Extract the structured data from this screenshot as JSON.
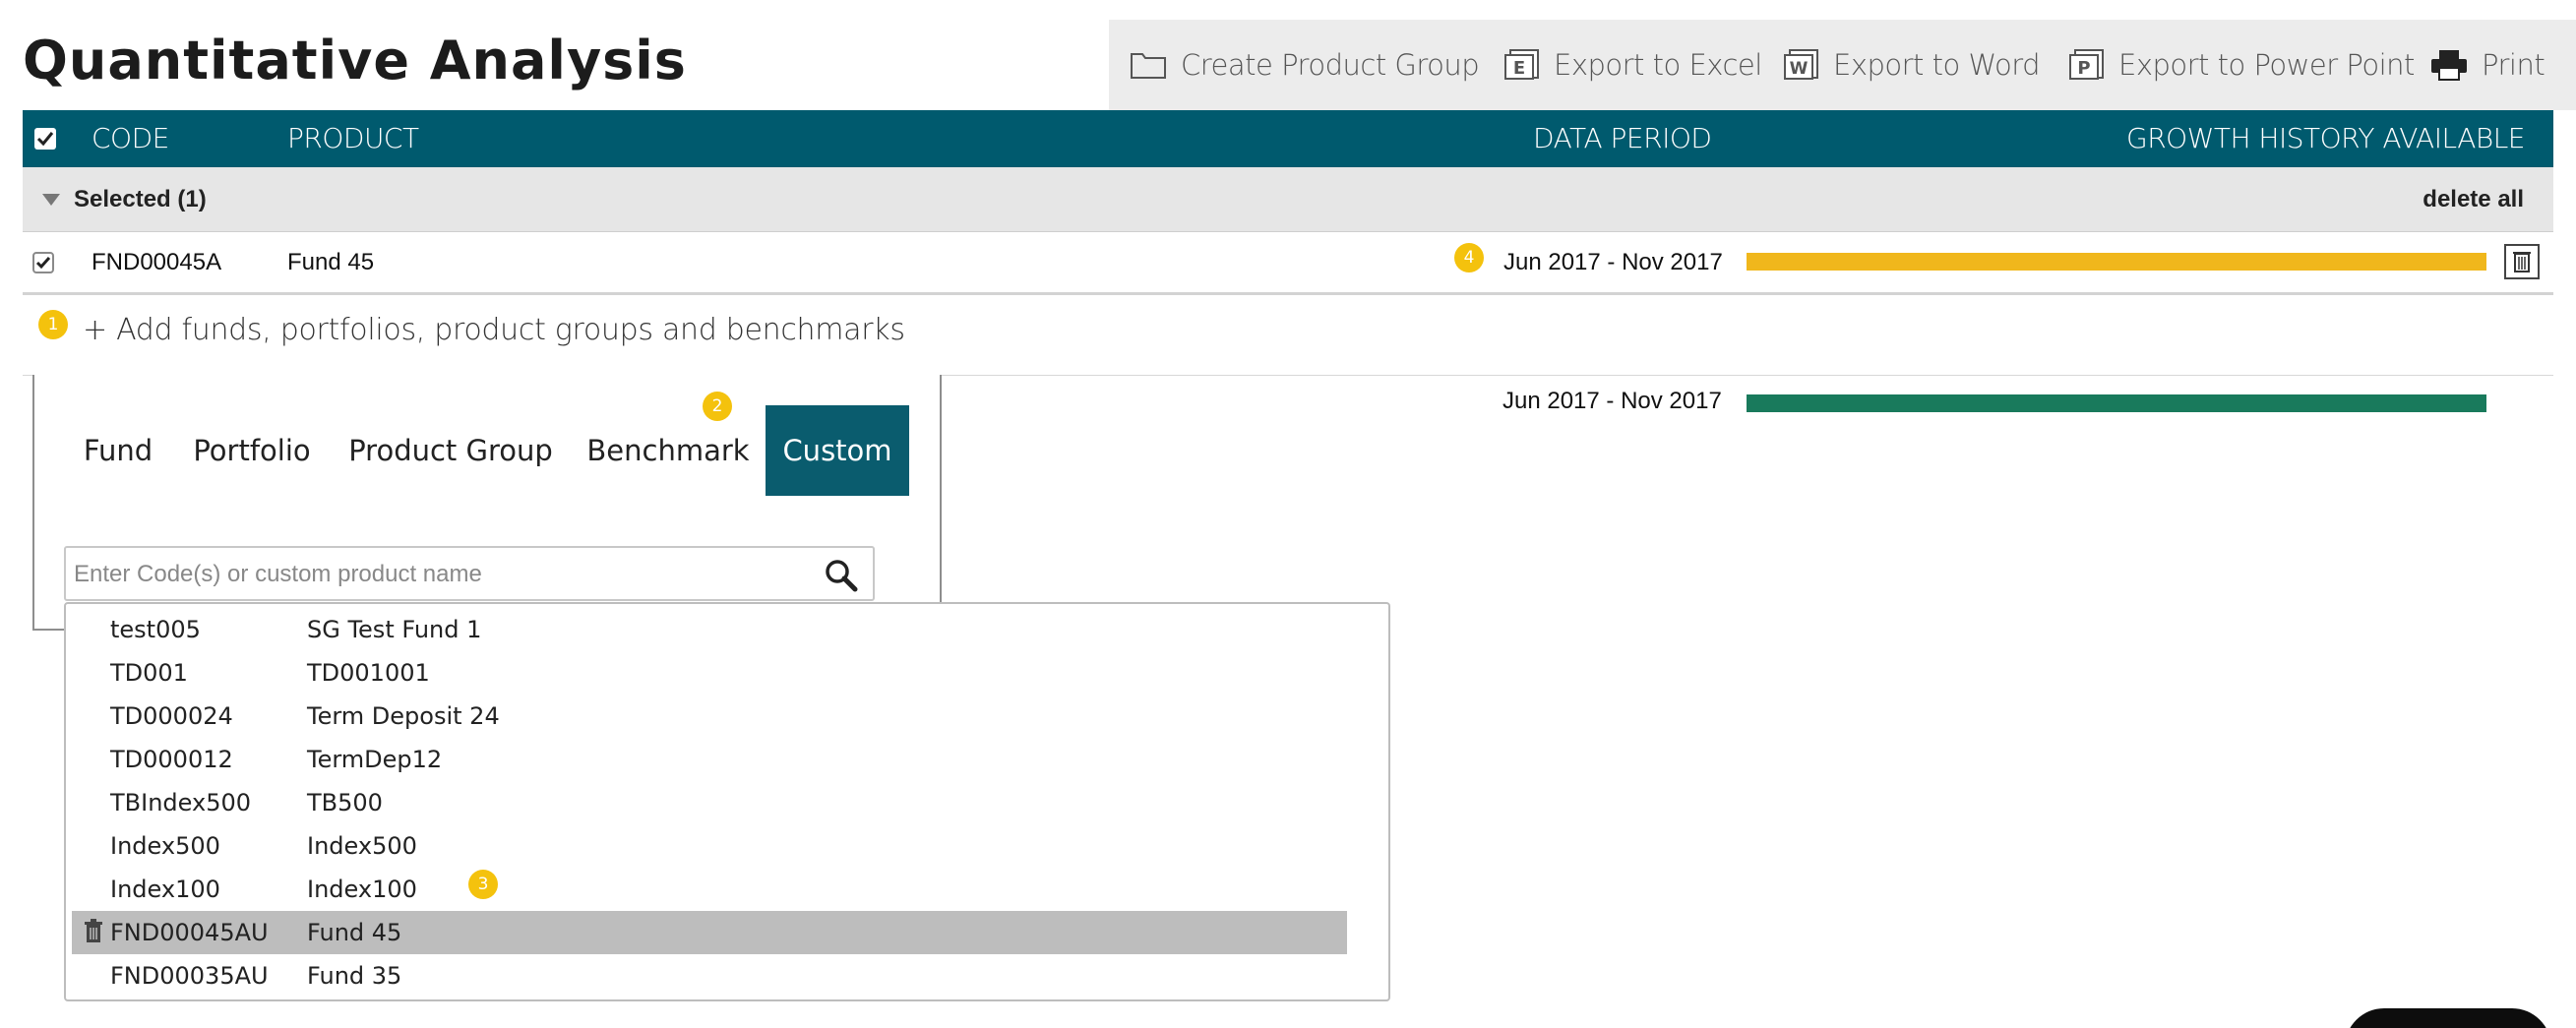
{
  "page": {
    "title": "Quantitative Analysis"
  },
  "toolbar": {
    "create_group": "Create Product Group",
    "export_excel": "Export to Excel",
    "export_word": "Export to Word",
    "export_ppt": "Export to Power Point",
    "print": "Print"
  },
  "table": {
    "columns": {
      "code": "CODE",
      "product": "PRODUCT",
      "data_period": "DATA PERIOD",
      "growth_history": "GROWTH HISTORY AVAILABLE"
    }
  },
  "group": {
    "label": "Selected (1)",
    "delete_all": "delete all"
  },
  "selected_row": {
    "code": "FND00045A",
    "product": "Fund 45",
    "period": "Jun 2017 - Nov 2017",
    "checked": true,
    "bar_color": "#f0b71c",
    "bar_fraction": 1.0
  },
  "badges": {
    "b1": "1",
    "b2": "2",
    "b3": "3",
    "b4": "4"
  },
  "add_link": "+ Add funds, portfolios, product groups and benchmarks",
  "benchmark_row": {
    "period": "Jun 2017 - Nov 2017",
    "bar_color": "#197a5c",
    "bar_fraction": 1.0
  },
  "tabs": [
    {
      "label": "Fund",
      "active": false
    },
    {
      "label": "Portfolio",
      "active": false
    },
    {
      "label": "Product Group",
      "active": false
    },
    {
      "label": "Benchmark",
      "active": false
    },
    {
      "label": "Custom",
      "active": true
    }
  ],
  "search": {
    "placeholder": "Enter Code(s) or custom product name",
    "value": ""
  },
  "results": [
    {
      "code": "test005",
      "name": "SG Test Fund 1"
    },
    {
      "code": "TD001",
      "name": "TD001001"
    },
    {
      "code": "TD000024",
      "name": "Term Deposit 24"
    },
    {
      "code": "TD000012",
      "name": "TermDep12"
    },
    {
      "code": "TBIndex500",
      "name": "TB500"
    },
    {
      "code": "Index500",
      "name": "Index500"
    },
    {
      "code": "Index100",
      "name": "Index100"
    },
    {
      "code": "FND00045AU",
      "name": "Fund 45",
      "highlighted": true
    },
    {
      "code": "FND00035AU",
      "name": "Fund 35"
    }
  ],
  "colors": {
    "header_teal": "#005a6e",
    "active_tab": "#0a5c6e",
    "badge_yellow": "#f4c20d",
    "toolbar_bg": "#ececec"
  },
  "icons": {
    "create_group": "folder-icon",
    "excel": "excel-icon",
    "word": "word-icon",
    "ppt": "powerpoint-icon",
    "print": "printer-icon",
    "search": "magnifier-icon",
    "row_delete": "trash-icon"
  }
}
